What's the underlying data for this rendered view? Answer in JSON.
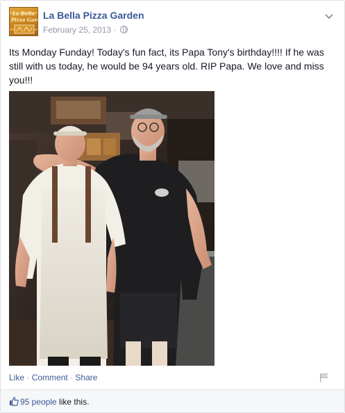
{
  "post": {
    "page_name": "La Bella Pizza Garden",
    "date": "February 25, 2013",
    "date_separator": "·",
    "avatar_logo_lines": [
      "La Bella",
      "Pizza Garden"
    ],
    "text": "Its Monday Funday! Today's fun fact, its Papa Tony's birthday!!!! If he was still with us today, he would be 94 years old. RIP Papa. We love and miss you!!!"
  },
  "actions": {
    "like": "Like",
    "comment": "Comment",
    "share": "Share",
    "separator": "·"
  },
  "likes": {
    "count_link": "95 people",
    "suffix": " like this."
  },
  "colors": {
    "link": "#3b5998",
    "meta": "#9197a3",
    "likes_bar_bg": "#f6f7f8"
  },
  "icons": [
    "chevron-down-icon",
    "globe-icon",
    "flag-icon",
    "thumbs-up-icon"
  ]
}
